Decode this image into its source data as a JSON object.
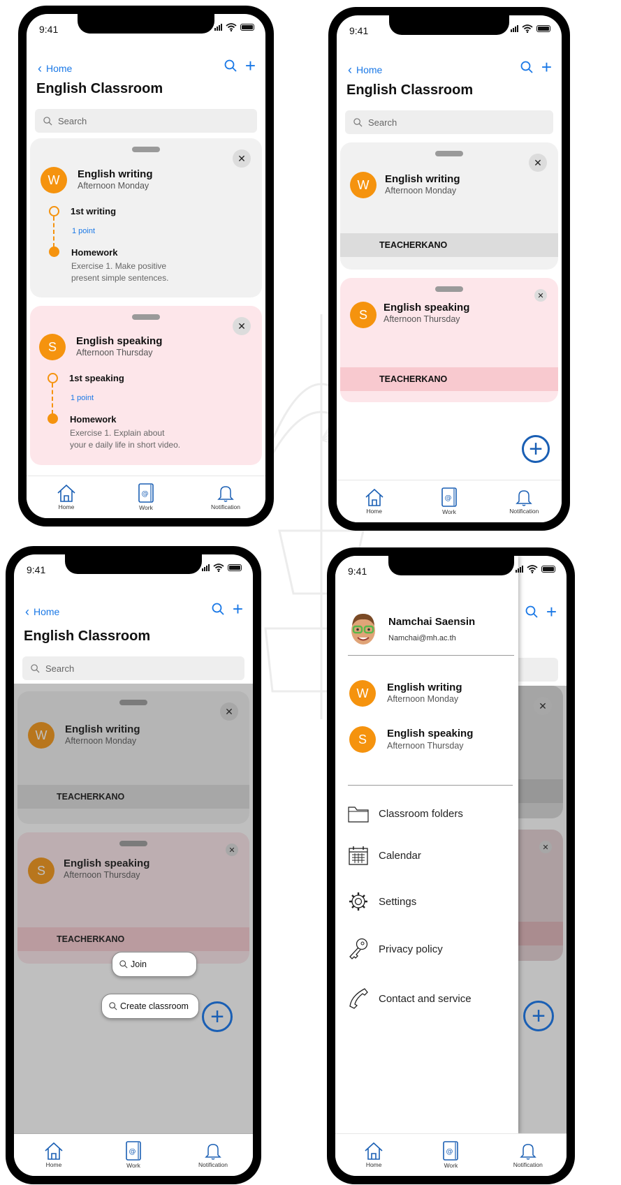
{
  "status": {
    "time": "9:41"
  },
  "nav": {
    "back_label": "Home",
    "title": "English Classroom",
    "search_placeholder": "Search"
  },
  "courses": [
    {
      "initial": "W",
      "name": "English writing",
      "schedule": "Afternoon Monday",
      "step1_title": "1st writing",
      "step1_point": "1 point",
      "step2_title": "Homework",
      "step2_desc": "Exercise 1. Make positive present simple sentences.",
      "teacher": "TEACHERKANO"
    },
    {
      "initial": "S",
      "name": "English speaking",
      "schedule": "Afternoon Thursday",
      "step1_title": "1st speaking",
      "step1_point": "1 point",
      "step2_title": "Homework",
      "step2_desc": "Exercise 1. Explain about your e daily life in short video.",
      "teacher": "TEACHERKANO"
    }
  ],
  "tabs": {
    "home": "Home",
    "work": "Work",
    "notification": "Notification"
  },
  "fab_menu": {
    "join": "Join",
    "create": "Create classroom"
  },
  "drawer": {
    "user_name": "Namchai Saensin",
    "user_email": "Namchai@mh.ac.th",
    "menu": {
      "folders": "Classroom folders",
      "calendar": "Calendar",
      "settings": "Settings",
      "privacy": "Privacy policy",
      "contact": "Contact and service"
    }
  },
  "colors": {
    "accent_blue": "#1a78e6",
    "orange": "#f5930e",
    "pink_card": "#fde6ea",
    "grey_card": "#f1f1f1"
  },
  "icons": [
    "search-icon",
    "plus-icon",
    "close-icon",
    "home-icon",
    "work-icon",
    "bell-icon",
    "folder-icon",
    "calendar-icon",
    "gear-icon",
    "key-icon",
    "phone-icon",
    "memoji-avatar"
  ]
}
